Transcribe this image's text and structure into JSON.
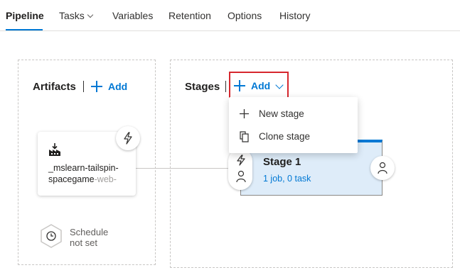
{
  "tabs": [
    {
      "label": "Pipeline",
      "active": true
    },
    {
      "label": "Tasks",
      "has_dropdown": true
    },
    {
      "label": "Variables"
    },
    {
      "label": "Retention"
    },
    {
      "label": "Options"
    },
    {
      "label": "History"
    }
  ],
  "artifacts": {
    "title": "Artifacts",
    "add_label": "Add",
    "card": {
      "line1": "_mslearn-tailspin-",
      "line2_main": "spacegame",
      "line2_fade": "-web-",
      "icon": "build-artifact-icon",
      "trigger_icon": "lightning-icon"
    },
    "schedule": {
      "line1": "Schedule",
      "line2": "not set",
      "icon": "clock-icon"
    }
  },
  "stages": {
    "title": "Stages",
    "add_label": "Add",
    "menu": [
      {
        "label": "New stage",
        "icon": "plus-icon"
      },
      {
        "label": "Clone stage",
        "icon": "clone-icon"
      }
    ],
    "stage": {
      "name": "Stage 1",
      "summary": "1 job, 0 task",
      "pre_icons": [
        "lightning-icon",
        "person-icon"
      ],
      "post_icon": "person-icon"
    }
  },
  "colors": {
    "accent": "#0078d4",
    "stage_bg": "#deecf9",
    "highlight": "#d6272e"
  }
}
